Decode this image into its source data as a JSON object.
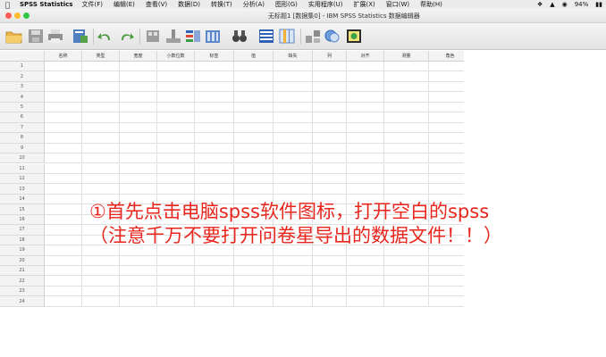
{
  "menubar": {
    "apple_icon": "apple-icon",
    "app_name": "SPSS Statistics",
    "items": [
      "文件(F)",
      "编辑(E)",
      "查看(V)",
      "数据(D)",
      "转换(T)",
      "分析(A)",
      "图形(G)",
      "实用程序(U)",
      "扩展(X)",
      "窗口(W)",
      "帮助(H)"
    ],
    "battery": "94%"
  },
  "window": {
    "title": "无标题1 [数据集0] - IBM SPSS Statistics 数据编辑器"
  },
  "grid": {
    "columns": [
      "名称",
      "类型",
      "宽度",
      "小数位数",
      "标签",
      "值",
      "缺失",
      "列",
      "对齐",
      "测量",
      "角色"
    ],
    "rows": [
      "1",
      "2",
      "3",
      "4",
      "5",
      "6",
      "7",
      "8",
      "9",
      "10",
      "11",
      "12",
      "13",
      "14",
      "15",
      "16",
      "17",
      "18",
      "19",
      "20",
      "21",
      "22",
      "23",
      "24"
    ]
  },
  "caption": {
    "line1": "①首先点击电脑spss软件图标，打开空白的spss",
    "line2": "（注意千万不要打开问卷星导出的数据文件！！）"
  },
  "colors": {
    "caption": "#e8261e",
    "close": "#fc5f57",
    "minimize": "#fdbc2e",
    "zoom": "#33c748"
  }
}
